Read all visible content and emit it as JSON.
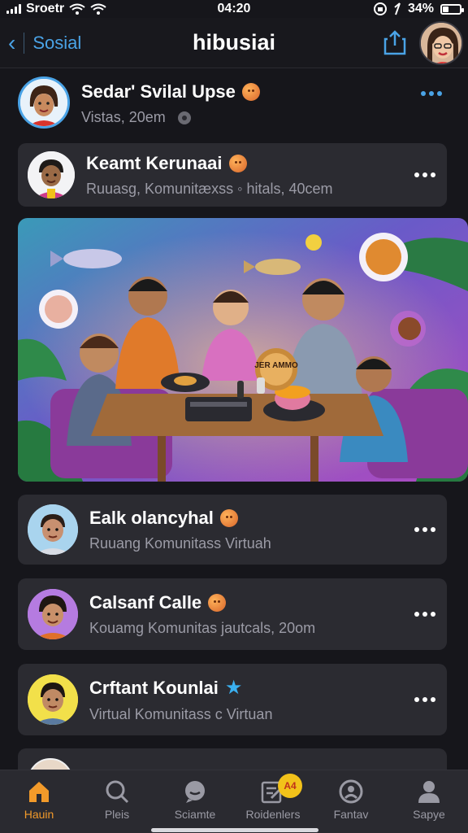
{
  "status_bar": {
    "carrier": "Sroetr",
    "time": "04:20",
    "battery_text": "34%",
    "battery_level": 0.34
  },
  "header": {
    "back_label": "Sosial",
    "title": "hibusiai"
  },
  "top_post": {
    "name": "Sedar' Svilal Upse",
    "subtitle": "Vistas, 20em"
  },
  "cards": [
    {
      "name": "Keamt Kerunaai",
      "subtitle": "Ruuasg, Komunitæxss ◦ hitals, 40cem",
      "avatar_color": "#f3f3f5",
      "badge": "emoji"
    },
    {
      "name": "Ealk olancyhal",
      "subtitle": "Ruuang Komunitass Virtuah",
      "avatar_color": "#a9d4ee",
      "badge": "emoji"
    },
    {
      "name": "Calsanf Calle",
      "subtitle": "Kouamg Komunitas jautcals, 20om",
      "avatar_color": "#b57be0",
      "badge": "crown-emoji"
    },
    {
      "name": "Crftant Kounlai",
      "subtitle": "Virtual Komunitass c Virtuan",
      "avatar_color": "#f2e04a",
      "badge": "star"
    }
  ],
  "hero": {
    "sign_text": "JER AMMO"
  },
  "tabbar": {
    "items": [
      {
        "label": "Hauin",
        "icon": "home-icon",
        "active": true
      },
      {
        "label": "Pleis",
        "icon": "search-icon",
        "active": false
      },
      {
        "label": "Sciamte",
        "icon": "chat-icon",
        "active": false
      },
      {
        "label": "Roidenlers",
        "icon": "edit-icon",
        "active": false,
        "badge": "A4"
      },
      {
        "label": "Fantav",
        "icon": "explore-icon",
        "active": false
      },
      {
        "label": "Sapye",
        "icon": "profile-icon",
        "active": false
      }
    ]
  },
  "colors": {
    "accent": "#4aa3e6",
    "active_tab": "#f29a2a",
    "card_bg": "#2b2b31",
    "page_bg": "#16161b"
  }
}
